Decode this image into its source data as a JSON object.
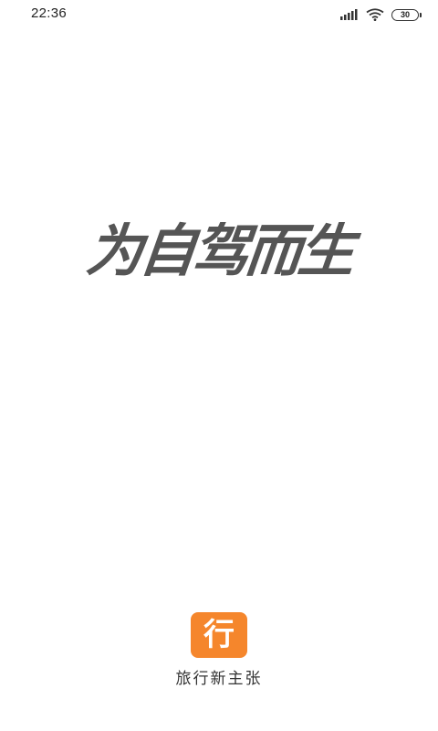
{
  "status_bar": {
    "time": "22:36",
    "battery_level": "30",
    "icons": [
      "signal-icon",
      "wifi-icon",
      "battery-icon"
    ]
  },
  "splash": {
    "slogan": "为自驾而生"
  },
  "branding": {
    "logo_char": "行",
    "app_name": "旅行新主张",
    "logo_color": "#f5862c"
  }
}
